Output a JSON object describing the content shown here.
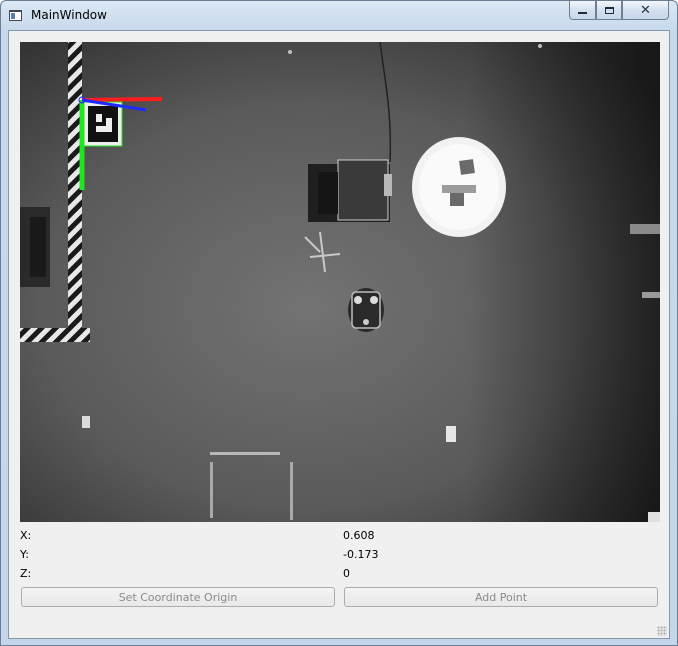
{
  "window": {
    "title": "MainWindow",
    "icon": "app-window-icon",
    "controls": {
      "minimize": "minimize-icon",
      "maximize": "maximize-icon",
      "close": "close-icon"
    }
  },
  "camera_view": {
    "description_icon": "camera-feed",
    "axis_colors": {
      "x": "#ff1e1e",
      "y": "#1ee61e",
      "z": "#1e2aff"
    }
  },
  "coordinates": {
    "x_label": "X:",
    "x_value": "0.608",
    "y_label": "Y:",
    "y_value": "-0.173",
    "z_label": "Z:",
    "z_value": "0"
  },
  "buttons": {
    "set_origin": "Set Coordinate Origin",
    "add_point": "Add Point"
  }
}
